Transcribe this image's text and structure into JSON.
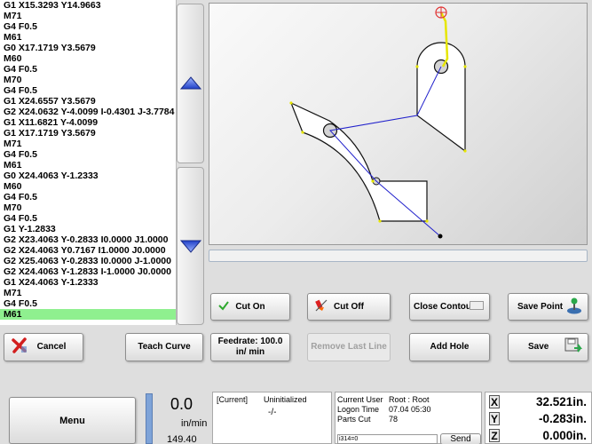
{
  "gcode": {
    "lines": [
      "G1 X15.3293 Y14.9663",
      "M71",
      "G4 F0.5",
      "M61",
      "G0 X17.1719 Y3.5679",
      "M60",
      "G4 F0.5",
      "M70",
      "G4 F0.5",
      "G1 X24.6557 Y3.5679",
      "G2 X24.0632 Y-4.0099 I-0.4301 J-3.7784",
      "G1 X11.6821 Y-4.0099",
      "G1 X17.1719 Y3.5679",
      "M71",
      "G4 F0.5",
      "M61",
      "G0 X24.4063 Y-1.2333",
      "M60",
      "G4 F0.5",
      "M70",
      "G4 F0.5",
      "G1 Y-1.2833",
      "G2 X23.4063 Y-0.2833 I0.0000 J1.0000",
      "G2 X24.4063 Y0.7167 I1.0000 J0.0000",
      "G2 X25.4063 Y-0.2833 I0.0000 J-1.0000",
      "G2 X24.4063 Y-1.2833 I-1.0000 J0.0000",
      "G1 X24.4063 Y-1.2333",
      "M71",
      "G4 F0.5",
      "M61"
    ],
    "selected_index": 29
  },
  "buttons": {
    "cut_on": "Cut On",
    "cut_off": "Cut Off",
    "close_contour": "Close Contour",
    "save_point": "Save Point",
    "cancel": "Cancel",
    "teach_curve": "Teach Curve",
    "feedrate": "Feedrate: 100.0 in/ min",
    "remove_last_line": "Remove Last Line",
    "add_hole": "Add Hole",
    "save": "Save",
    "menu": "Menu"
  },
  "status": {
    "feed_value": "0.0",
    "feed_unit": "in/min",
    "feed_secondary": "149.40",
    "current_label": "[Current]",
    "current_state": "Uninitialized",
    "current_sub": "-/-",
    "current_user_label": "Current User",
    "current_user_value": "Root : Root",
    "logon_time_label": "Logon Time",
    "logon_time_value": "07.04 05:30",
    "parts_cut_label": "Parts Cut",
    "parts_cut_value": "78",
    "command_input": "i314=0",
    "send_label": "Send"
  },
  "coords": {
    "x_label": "X",
    "x_value": "32.521in.",
    "y_label": "Y",
    "y_value": "-0.283in.",
    "z_label": "Z",
    "z_value": "0.000in."
  },
  "icons": {
    "cut_on": "checkmark-icon",
    "cut_off": "torch-off-icon",
    "close_contour": "toggle-icon",
    "save_point": "joystick-icon",
    "cancel": "x-icon",
    "save": "save-icon",
    "scroll_up": "arrow-up-icon",
    "scroll_down": "arrow-down-icon"
  },
  "colors": {
    "selected_line": "#8ff08f",
    "path_line": "#2222cc",
    "torch_marker": "#e03030",
    "rapid_line": "#e6e600"
  }
}
